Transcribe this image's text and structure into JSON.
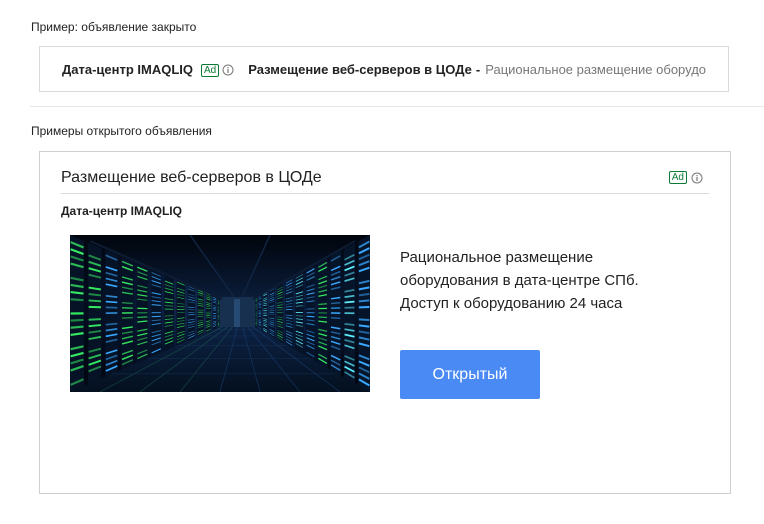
{
  "captions": {
    "closed": "Пример: объявление закрыто",
    "open": "Примеры открытого объявления"
  },
  "ad": {
    "advertiser": "Дата-центр IMAQLIQ",
    "badge": "Ad",
    "headline": "Размещение веб-серверов в ЦОДе",
    "separator": "-",
    "collapsed_description": "Рациональное размещение оборудо",
    "description_lines": [
      "Рациональное размещение",
      "оборудования в дата-центре СПб.",
      "Доступ к оборудованию 24 часа"
    ],
    "cta_label": "Открытый"
  },
  "colors": {
    "badge_green": "#0c7a34",
    "cta_blue": "#4a8af4",
    "server_green": "#34e860",
    "server_blue": "#3aa8ff",
    "server_cyan": "#5ef0ff"
  },
  "icons": {
    "info": "info-circle-icon"
  }
}
